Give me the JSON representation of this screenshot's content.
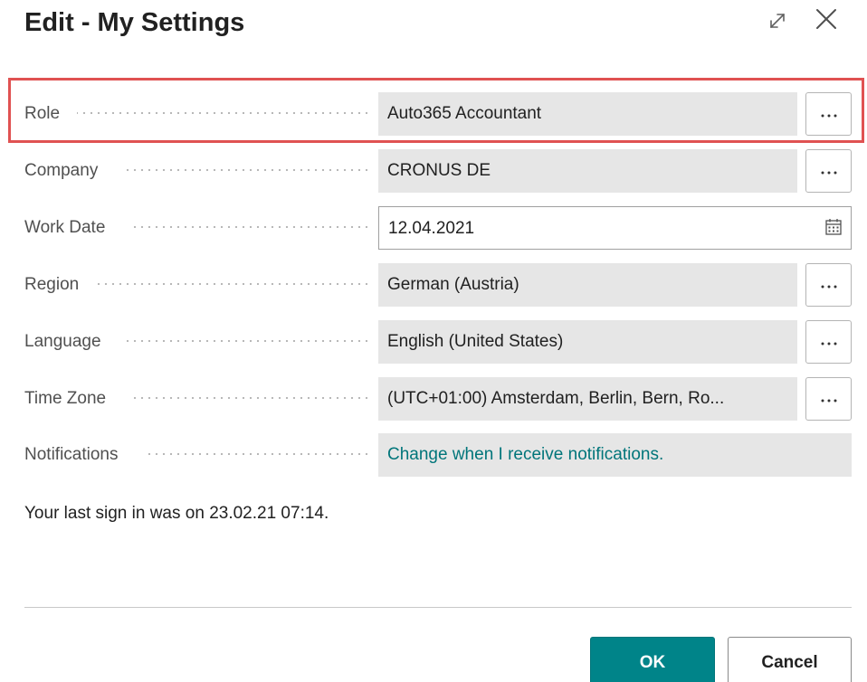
{
  "dialog": {
    "title": "Edit - My Settings"
  },
  "fields": {
    "role": {
      "label": "Role",
      "value": "Auto365 Accountant"
    },
    "company": {
      "label": "Company",
      "value": "CRONUS DE"
    },
    "work_date": {
      "label": "Work Date",
      "value": "12.04.2021"
    },
    "region": {
      "label": "Region",
      "value": "German (Austria)"
    },
    "language": {
      "label": "Language",
      "value": "English (United States)"
    },
    "time_zone": {
      "label": "Time Zone",
      "value": "(UTC+01:00) Amsterdam, Berlin, Bern, Ro..."
    },
    "notifications": {
      "label": "Notifications",
      "value": "Change when I receive notifications."
    }
  },
  "last_signin": "Your last sign in was on 23.02.21 07:14.",
  "buttons": {
    "ok": "OK",
    "cancel": "Cancel"
  },
  "colors": {
    "accent": "#008489",
    "link": "#00757a",
    "highlight_border": "#e05252",
    "field_background": "#e6e6e6"
  },
  "icons": {
    "expand": "expand-icon",
    "close": "close-icon",
    "lookup": "more-icon",
    "date_picker": "calendar-icon"
  }
}
